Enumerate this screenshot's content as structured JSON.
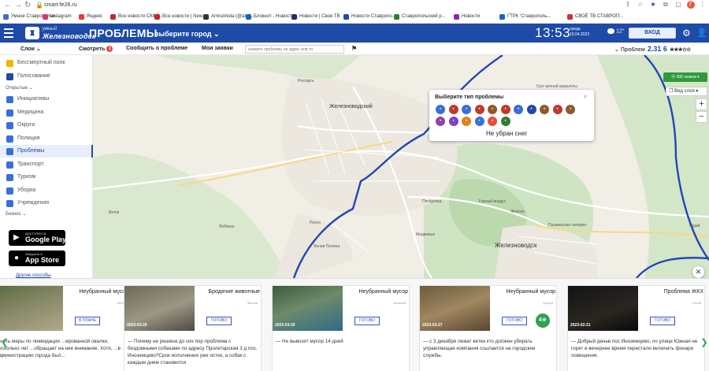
{
  "browser": {
    "url": "smart-fe26.ru",
    "bookmarks": [
      {
        "label": "Умное Ставрополье",
        "color": "#3b6fd6"
      },
      {
        "label": "Instagram",
        "color": "#d6336c"
      },
      {
        "label": "Яндекс",
        "color": "#e53935"
      },
      {
        "label": "Все новости СКФО...",
        "color": "#c62828"
      },
      {
        "label": "Все новости | New...",
        "color": "#c62828"
      },
      {
        "label": "AmiraVeda (@amir...",
        "color": "#333333"
      },
      {
        "label": "Блокнот - Новости...",
        "color": "#1565c0"
      },
      {
        "label": "Новости | Своё ТВ",
        "color": "#2a2a6a"
      },
      {
        "label": "Новости Ставропо...",
        "color": "#1e4aa8"
      },
      {
        "label": "Ставропольский р...",
        "color": "#2e7d32"
      },
      {
        "label": "Новости",
        "color": "#8e24aa"
      },
      {
        "label": "ГТРК 'Ставрополь...",
        "color": "#1565c0"
      },
      {
        "label": "СВОЁ ТВ СТАВРОП...",
        "color": "#d32f2f"
      }
    ]
  },
  "header": {
    "logo_line1": "умный",
    "logo_line2": "Железноводск",
    "title": "ПРОБЛЕМЫ",
    "city_select": "выберите город ⌄",
    "time": "13:53",
    "day": "среда",
    "date": "19.04.2023",
    "temperature": "12°",
    "login_label": "ВХОД"
  },
  "subnav": {
    "layers": "Слои ⌄",
    "watch": "Смотреть",
    "watch_badge": "1",
    "report": "Сообщить о проблеме",
    "my_requests": "Мои заявки",
    "search_placeholder": "укажите проблему, ее адрес или то",
    "rating_label": "Проблем",
    "rating_value": "2.31 6",
    "stars": "★★★☆☆"
  },
  "sidebar": {
    "top_items": [
      {
        "label": "Бессмертный полк",
        "color": "#f4b400"
      },
      {
        "label": "Голосование",
        "color": "#1e4aa8"
      }
    ],
    "open_label": "Открытые ⌄",
    "open_items": [
      {
        "label": "Инициативы",
        "color": "#3a6fd8"
      },
      {
        "label": "Медицина",
        "color": "#3a6fd8"
      },
      {
        "label": "Округа",
        "color": "#3a6fd8"
      },
      {
        "label": "Полиция",
        "color": "#3a6fd8"
      },
      {
        "label": "Проблемы",
        "color": "#3a6fd8"
      },
      {
        "label": "Транспорт",
        "color": "#3a6fd8"
      },
      {
        "label": "Туризм",
        "color": "#3a6fd8"
      },
      {
        "label": "Уборка",
        "color": "#3a6fd8"
      },
      {
        "label": "Учреждения",
        "color": "#3a6fd8"
      }
    ],
    "business_label": "Бизнес ⌄",
    "google_small": "ДОСТУПНО В",
    "google_big": "Google Play",
    "apple_small": "Загрузите в",
    "apple_big": "App Store",
    "other_ways": "Другие способы"
  },
  "map": {
    "labels": [
      {
        "text": "Железноводский",
        "size": 7
      },
      {
        "text": "Железноводск",
        "size": 8
      },
      {
        "text": "Росгарть",
        "size": 5
      },
      {
        "text": "Пятёрочка",
        "size": 5
      },
      {
        "text": "Горный воздух",
        "size": 5
      },
      {
        "text": "Медвежья",
        "size": 5
      },
      {
        "text": "Жеяска",
        "size": 5
      },
      {
        "text": "Лебёнок",
        "size": 5
      },
      {
        "text": "Веток",
        "size": 5
      },
      {
        "text": "Ресно",
        "size": 5
      },
      {
        "text": "Ясная Поляна",
        "size": 5
      },
      {
        "text": "Грот вечной мерзлоты",
        "size": 5
      },
      {
        "text": "Пушкинская галерея",
        "size": 5
      },
      {
        "text": "Юдай",
        "size": 5
      }
    ],
    "layer_button": "300 знаков ▾",
    "view_select": "Вид слоя ▾",
    "zoom_in": "+",
    "zoom_out": "−"
  },
  "popup": {
    "title": "Выберите тип проблемы",
    "selected": "Не убран снег",
    "icon_colors": [
      "#3a6fd8",
      "#c0392b",
      "#3a6fd8",
      "#c0392b",
      "#8e5a2b",
      "#c0392b",
      "#3a6fd8",
      "#1e4aa8",
      "#8e5a2b",
      "#c0392b",
      "#8e5a2b",
      "#8e44ad",
      "#7f3fbf",
      "#e67e22",
      "#3a6fd8",
      "#e74c3c",
      "#2e7d32"
    ]
  },
  "feed": {
    "cards": [
      {
        "title": "Неубранный мусор",
        "author": "Кения",
        "date": "",
        "status": "В ПЛАНЕ",
        "text": "...нять меры по ликвидации ...ированной свалки, несколько лет ...обращает на нее внимание. Хотя, ...в Администрацию города был..."
      },
      {
        "title": "Бродячие животные",
        "author": "Эксана",
        "date": "2023-03-20",
        "status": "ГОТОВО",
        "text": "— Почему не решена до сих пор проблема с бездомными собаками по адресу Пролетарская 3 д пос. Иноземцево?Срок исполнения уже истек, а собак с каждым днем становится"
      },
      {
        "title": "Неубранный мусор",
        "author": "Алексей",
        "date": "2023-03-20",
        "status": "ГОТОВО",
        "text": "— Не вывозят мусор 14 дней"
      },
      {
        "title": "Неубранный мусор",
        "author": "Сергей",
        "date": "2023-03-27",
        "status": "ГОТОВО",
        "text": "— с 3 декабря лежат ветки кто должен убирать управляющая компания ссылается на городские службы."
      },
      {
        "title": "Проблема ЖКХ",
        "author": "Юрий",
        "date": "2023-02-21",
        "status": "ГОТОВО",
        "text": "— Добрый деньв пос Иноземцево, по улице Южная не горят в вечернее время перестали включать фонари освещения."
      }
    ],
    "stamp": "4★"
  }
}
